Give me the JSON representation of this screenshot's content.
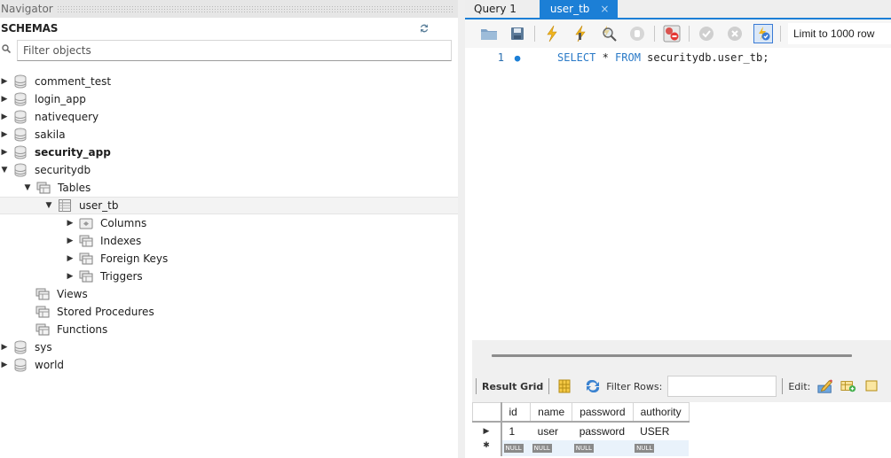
{
  "navigator": {
    "title": "Navigator",
    "schemas_label": "SCHEMAS",
    "filter_placeholder": "Filter objects",
    "tree": [
      {
        "label": "comment_test",
        "level": 0,
        "expanded": false,
        "icon": "database-icon",
        "bold": false
      },
      {
        "label": "login_app",
        "level": 0,
        "expanded": false,
        "icon": "database-icon",
        "bold": false
      },
      {
        "label": "nativequery",
        "level": 0,
        "expanded": false,
        "icon": "database-icon",
        "bold": false
      },
      {
        "label": "sakila",
        "level": 0,
        "expanded": false,
        "icon": "database-icon",
        "bold": false
      },
      {
        "label": "security_app",
        "level": 0,
        "expanded": false,
        "icon": "database-icon",
        "bold": true
      },
      {
        "label": "securitydb",
        "level": 0,
        "expanded": true,
        "icon": "database-icon",
        "bold": false
      },
      {
        "label": "Tables",
        "level": 1,
        "expanded": true,
        "icon": "tables-folder-icon"
      },
      {
        "label": "user_tb",
        "level": 2,
        "expanded": true,
        "icon": "table-icon",
        "selected": true
      },
      {
        "label": "Columns",
        "level": 3,
        "expanded": false,
        "icon": "columns-folder-icon"
      },
      {
        "label": "Indexes",
        "level": 3,
        "expanded": false,
        "icon": "indexes-folder-icon"
      },
      {
        "label": "Foreign Keys",
        "level": 3,
        "expanded": false,
        "icon": "foreign-keys-folder-icon"
      },
      {
        "label": "Triggers",
        "level": 3,
        "expanded": false,
        "icon": "triggers-folder-icon"
      },
      {
        "label": "Views",
        "level": 1,
        "icon": "views-folder-icon"
      },
      {
        "label": "Stored Procedures",
        "level": 1,
        "icon": "procedures-folder-icon"
      },
      {
        "label": "Functions",
        "level": 1,
        "icon": "functions-folder-icon"
      },
      {
        "label": "sys",
        "level": 0,
        "expanded": false,
        "icon": "database-icon",
        "bold": false
      },
      {
        "label": "world",
        "level": 0,
        "expanded": false,
        "icon": "database-icon",
        "bold": false
      }
    ]
  },
  "editor": {
    "tabs": [
      {
        "label": "Query 1",
        "active": false
      },
      {
        "label": "user_tb",
        "active": true,
        "close": "×"
      }
    ],
    "toolbar": {
      "limit_label": "Limit to 1000 row"
    },
    "code": {
      "line_number": "1",
      "keyword1": "SELECT",
      "star": " * ",
      "keyword2": "FROM",
      "rest": " securitydb.user_tb;"
    }
  },
  "result": {
    "result_grid_label": "Result Grid",
    "filter_rows_label": "Filter Rows:",
    "filter_rows_value": "",
    "edit_label": "Edit:",
    "columns": [
      "id",
      "name",
      "password",
      "authority"
    ],
    "rows": [
      [
        "1",
        "user",
        "password",
        "USER"
      ]
    ],
    "null_label": "NULL"
  },
  "colors": {
    "accent": "#1c7fd6",
    "keyword": "#2a7ac7"
  }
}
